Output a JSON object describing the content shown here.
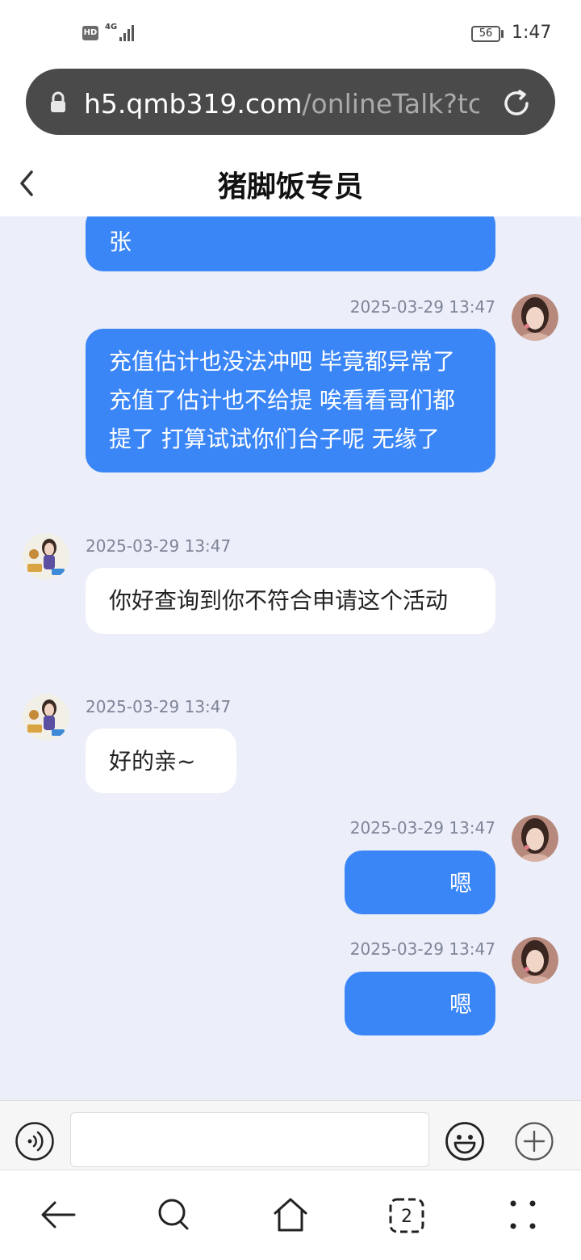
{
  "status_bar": {
    "hd": "HD",
    "network": "4G",
    "battery": "56",
    "time": "1:47"
  },
  "browser": {
    "url_host": "h5.qmb319.com",
    "url_path": "/onlineTalk?tc",
    "tabs_count": "2"
  },
  "header": {
    "title": "猪脚饭专员"
  },
  "messages": [
    {
      "side": "out",
      "text": "张"
    },
    {
      "side": "out",
      "time": "2025-03-29 13:47",
      "text": "充值估计也没法冲吧   毕竟都异常了   充值了估计也不给提   唉看看哥们都提了   打算试试你们台子呢   无缘了"
    },
    {
      "side": "in",
      "time": "2025-03-29 13:47",
      "text": "你好查询到你不符合申请这个活动"
    },
    {
      "side": "in",
      "time": "2025-03-29 13:47",
      "text": "好的亲~"
    },
    {
      "side": "out",
      "time": "2025-03-29 13:47",
      "text": "嗯"
    },
    {
      "side": "out",
      "time": "2025-03-29 13:47",
      "text": "嗯"
    }
  ],
  "input": {
    "value": "",
    "placeholder": ""
  },
  "colors": {
    "outgoing_bubble": "#3b86f7",
    "incoming_bubble": "#ffffff",
    "chat_background": "#eceffa",
    "url_bar": "#4a4a4a"
  },
  "icons": {
    "lock": "lock-icon",
    "reload": "reload-icon",
    "back": "chevron-left-icon",
    "voice": "voice-icon",
    "emoji": "smiley-icon",
    "plus": "plus-icon",
    "nav_back": "arrow-left-icon",
    "nav_search": "search-icon",
    "nav_home": "home-icon",
    "nav_tabs": "tabs-icon",
    "nav_menu": "menu-dots-icon"
  }
}
